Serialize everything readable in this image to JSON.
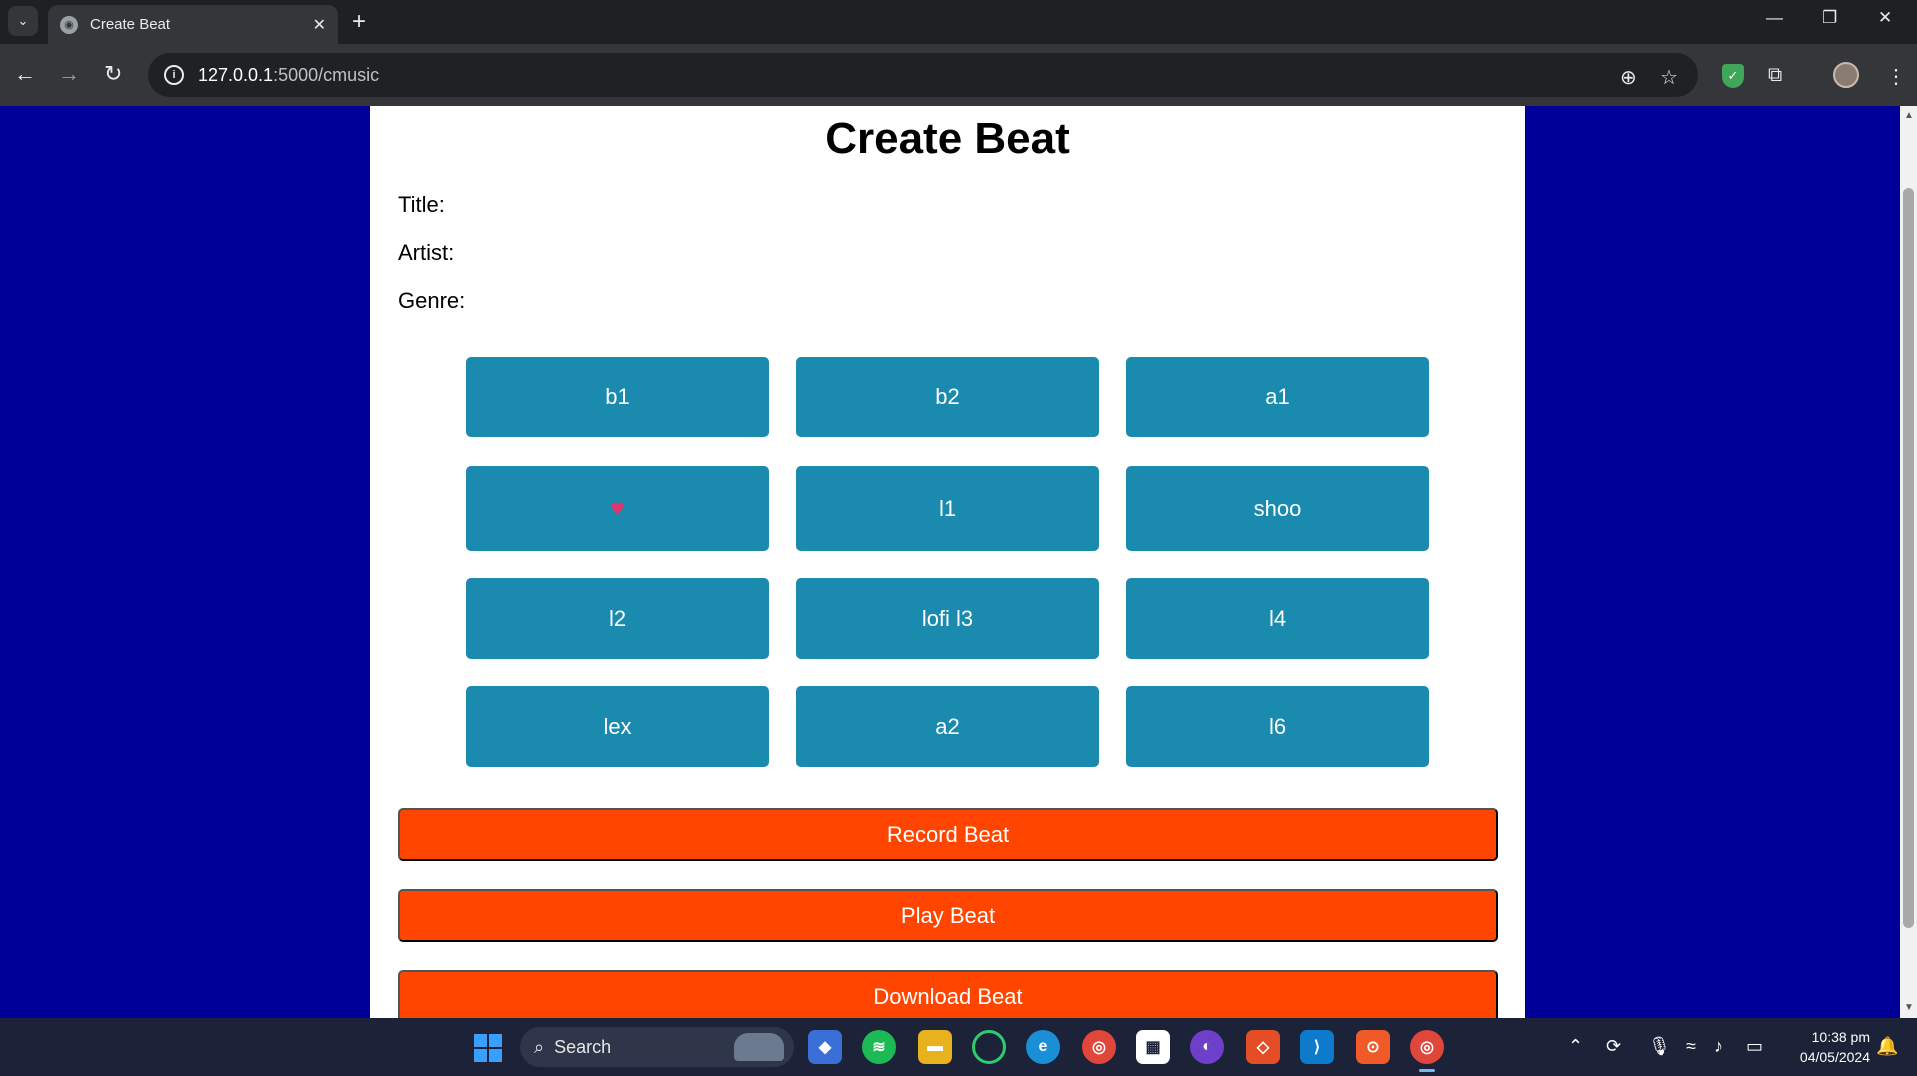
{
  "browser": {
    "tab_title": "Create Beat",
    "url_host": "127.0.0.1",
    "url_rest": ":5000/cmusic"
  },
  "page": {
    "title": "Create Beat",
    "fields": {
      "title_label": "Title:",
      "artist_label": "Artist:",
      "genre_label": "Genre:"
    },
    "pads": [
      {
        "label": "b1"
      },
      {
        "label": "b2"
      },
      {
        "label": "a1"
      },
      {
        "label": "♥",
        "icon": "heart-icon"
      },
      {
        "label": "l1"
      },
      {
        "label": "shoo"
      },
      {
        "label": "l2"
      },
      {
        "label": "lofi l3"
      },
      {
        "label": "l4"
      },
      {
        "label": "lex"
      },
      {
        "label": "a2"
      },
      {
        "label": "l6"
      }
    ],
    "actions": {
      "record": "Record Beat",
      "play": "Play Beat",
      "download": "Download Beat"
    },
    "colors": {
      "background": "#000099",
      "pad": "#1a8aaf",
      "action": "#ff4500"
    }
  },
  "taskbar": {
    "search_placeholder": "Search",
    "time": "10:38 pm",
    "date": "04/05/2024"
  }
}
